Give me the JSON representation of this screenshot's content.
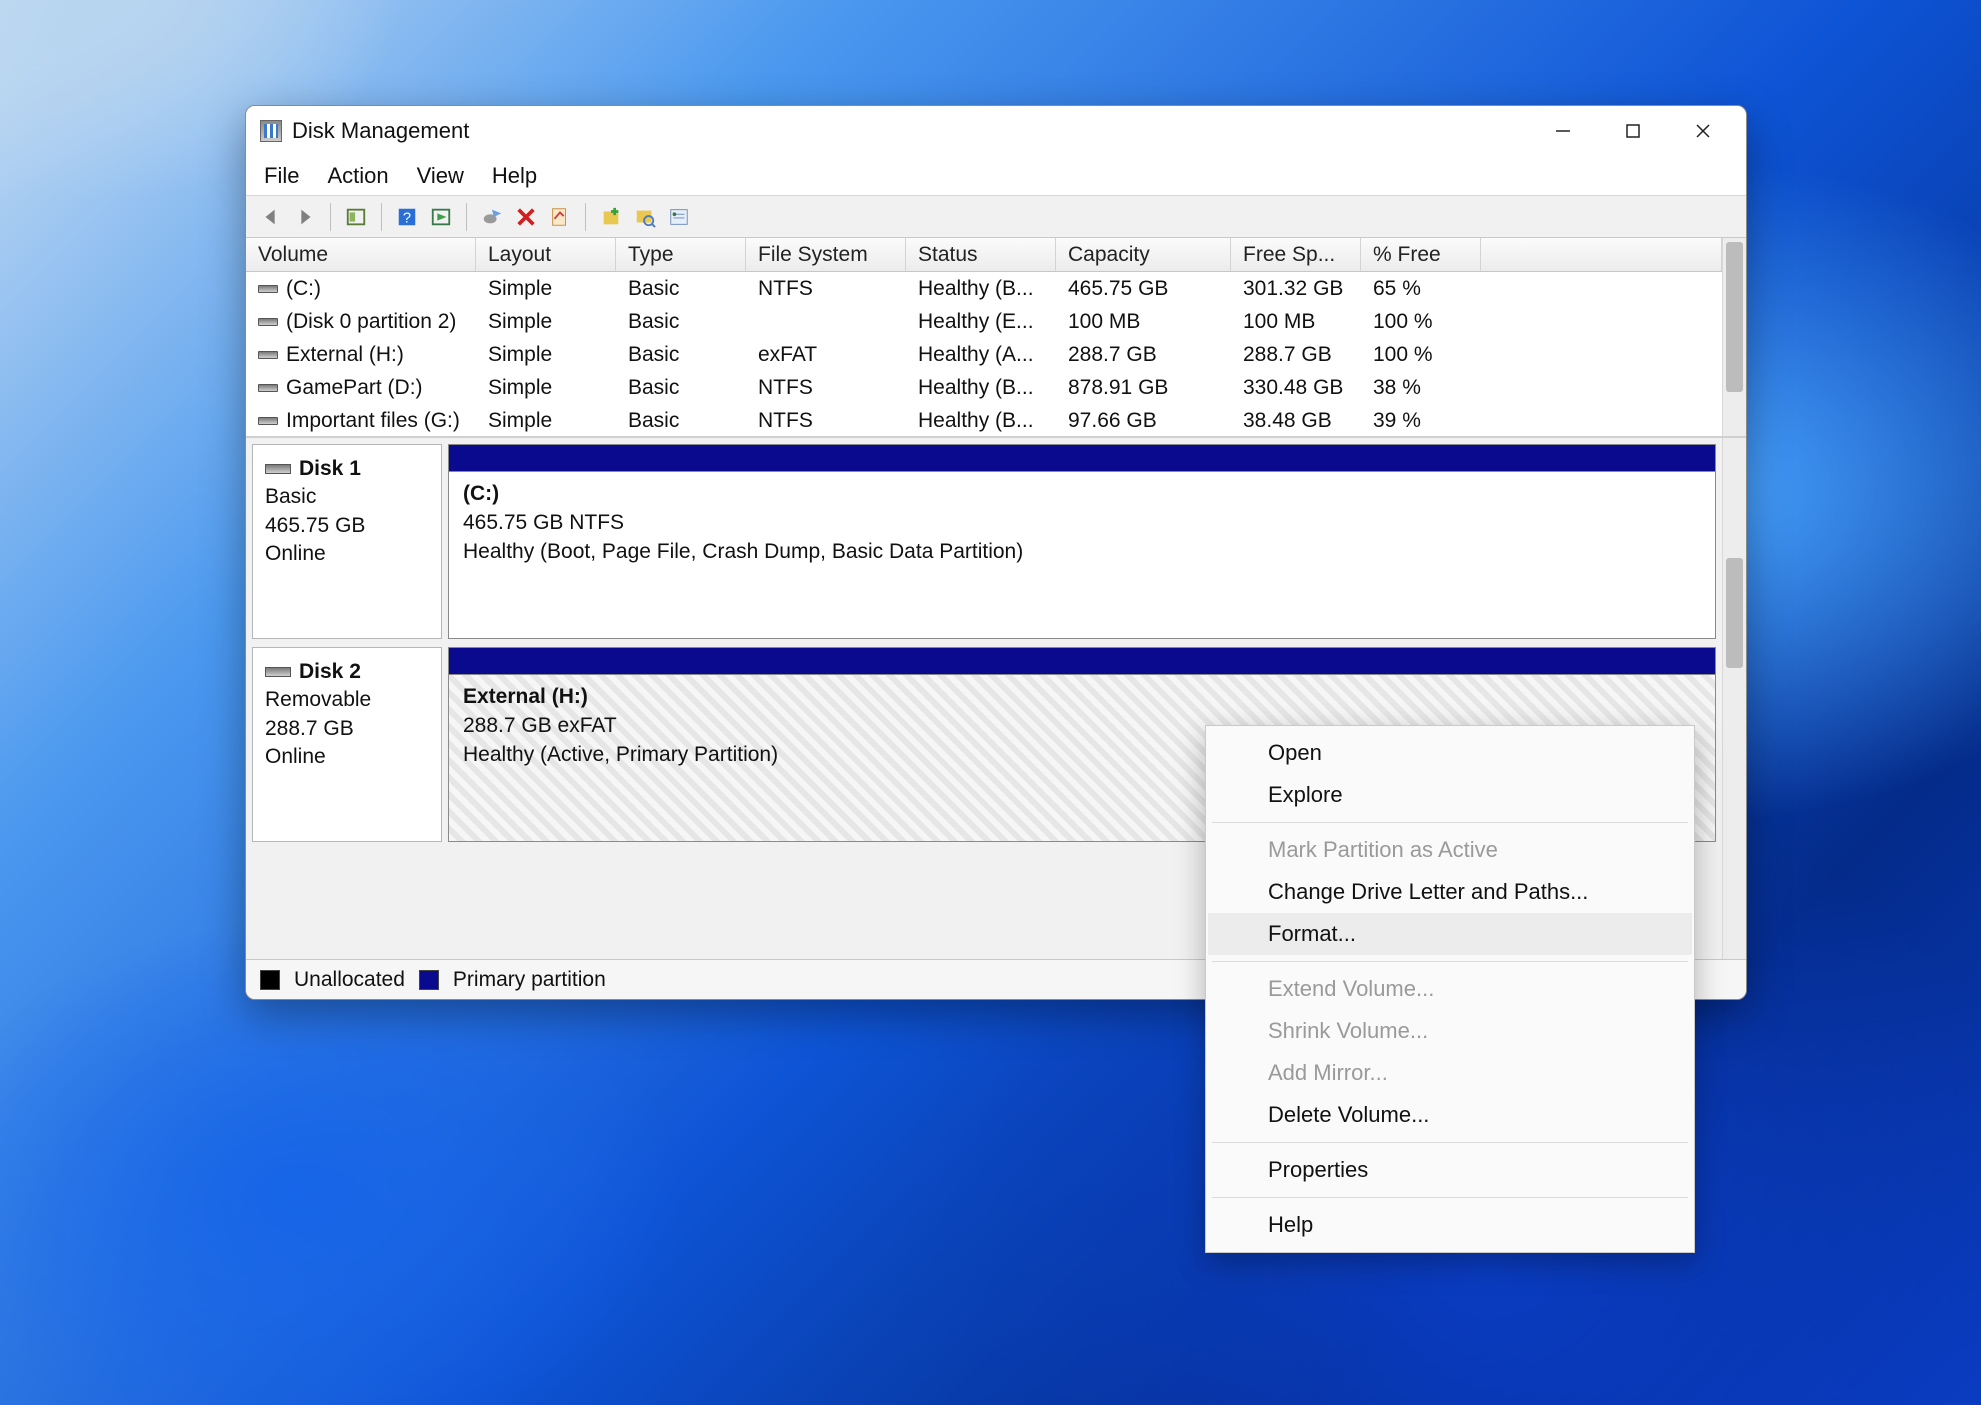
{
  "window": {
    "title": "Disk Management",
    "menu": {
      "file": "File",
      "action": "Action",
      "view": "View",
      "help": "Help"
    },
    "columns": {
      "volume": "Volume",
      "layout": "Layout",
      "type": "Type",
      "filesystem": "File System",
      "status": "Status",
      "capacity": "Capacity",
      "freespace": "Free Sp...",
      "pctfree": "% Free"
    },
    "volumes": [
      {
        "name": "(C:)",
        "layout": "Simple",
        "type": "Basic",
        "fs": "NTFS",
        "status": "Healthy (B...",
        "capacity": "465.75 GB",
        "free": "301.32 GB",
        "pct": "65 %"
      },
      {
        "name": "(Disk 0 partition 2)",
        "layout": "Simple",
        "type": "Basic",
        "fs": "",
        "status": "Healthy (E...",
        "capacity": "100 MB",
        "free": "100 MB",
        "pct": "100 %"
      },
      {
        "name": "External (H:)",
        "layout": "Simple",
        "type": "Basic",
        "fs": "exFAT",
        "status": "Healthy (A...",
        "capacity": "288.7 GB",
        "free": "288.7 GB",
        "pct": "100 %"
      },
      {
        "name": "GamePart (D:)",
        "layout": "Simple",
        "type": "Basic",
        "fs": "NTFS",
        "status": "Healthy (B...",
        "capacity": "878.91 GB",
        "free": "330.48 GB",
        "pct": "38 %"
      },
      {
        "name": "Important files (G:)",
        "layout": "Simple",
        "type": "Basic",
        "fs": "NTFS",
        "status": "Healthy (B...",
        "capacity": "97.66 GB",
        "free": "38.48 GB",
        "pct": "39 %"
      }
    ],
    "disks": [
      {
        "label": "Disk 1",
        "kind": "Basic",
        "size": "465.75 GB",
        "state": "Online",
        "part": {
          "title": "(C:)",
          "size_fs": "465.75 GB NTFS",
          "status": "Healthy (Boot, Page File, Crash Dump, Basic Data Partition)"
        }
      },
      {
        "label": "Disk 2",
        "kind": "Removable",
        "size": "288.7 GB",
        "state": "Online",
        "part": {
          "title": "External  (H:)",
          "size_fs": "288.7 GB exFAT",
          "status": "Healthy (Active, Primary Partition)"
        }
      }
    ],
    "legend": {
      "unallocated": "Unallocated",
      "primary": "Primary partition"
    }
  },
  "context_menu": {
    "open": "Open",
    "explore": "Explore",
    "mark_active": "Mark Partition as Active",
    "change_letter": "Change Drive Letter and Paths...",
    "format": "Format...",
    "extend": "Extend Volume...",
    "shrink": "Shrink Volume...",
    "add_mirror": "Add Mirror...",
    "delete": "Delete Volume...",
    "properties": "Properties",
    "help": "Help"
  }
}
